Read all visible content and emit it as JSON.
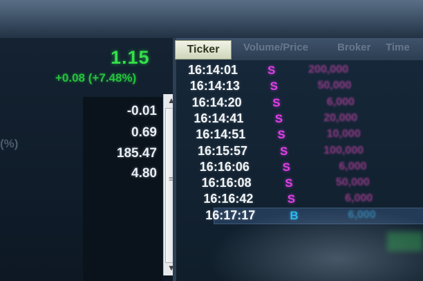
{
  "quote": {
    "price": "1.15",
    "change": "+0.08 (+7.48%)"
  },
  "stats": [
    "-0.01",
    "0.69",
    "185.47",
    "4.80"
  ],
  "left_partial": "(%)",
  "trade_table": {
    "tabs": [
      "Ticker",
      "Volume/Price",
      "Broker",
      "Time"
    ],
    "rows": [
      {
        "time": "16:14:01",
        "side": "S",
        "value": "200,000"
      },
      {
        "time": "16:14:13",
        "side": "S",
        "value": "50,000"
      },
      {
        "time": "16:14:20",
        "side": "S",
        "value": "6,000"
      },
      {
        "time": "16:14:41",
        "side": "S",
        "value": "20,000"
      },
      {
        "time": "16:14:51",
        "side": "S",
        "value": "10,000"
      },
      {
        "time": "16:15:57",
        "side": "S",
        "value": "100,000"
      },
      {
        "time": "16:16:06",
        "side": "S",
        "value": "6,000"
      },
      {
        "time": "16:16:08",
        "side": "S",
        "value": "50,000"
      },
      {
        "time": "16:16:42",
        "side": "S",
        "value": "6,000"
      },
      {
        "time": "16:17:17",
        "side": "B",
        "value": "6,000"
      }
    ],
    "selected_index": 9
  },
  "colors": {
    "price_up": "#34e04a",
    "sell": "#e040e8",
    "buy": "#29b8f0"
  },
  "icons": {
    "scroll_up": "up-arrow-icon",
    "scroll_down": "down-arrow-icon"
  }
}
